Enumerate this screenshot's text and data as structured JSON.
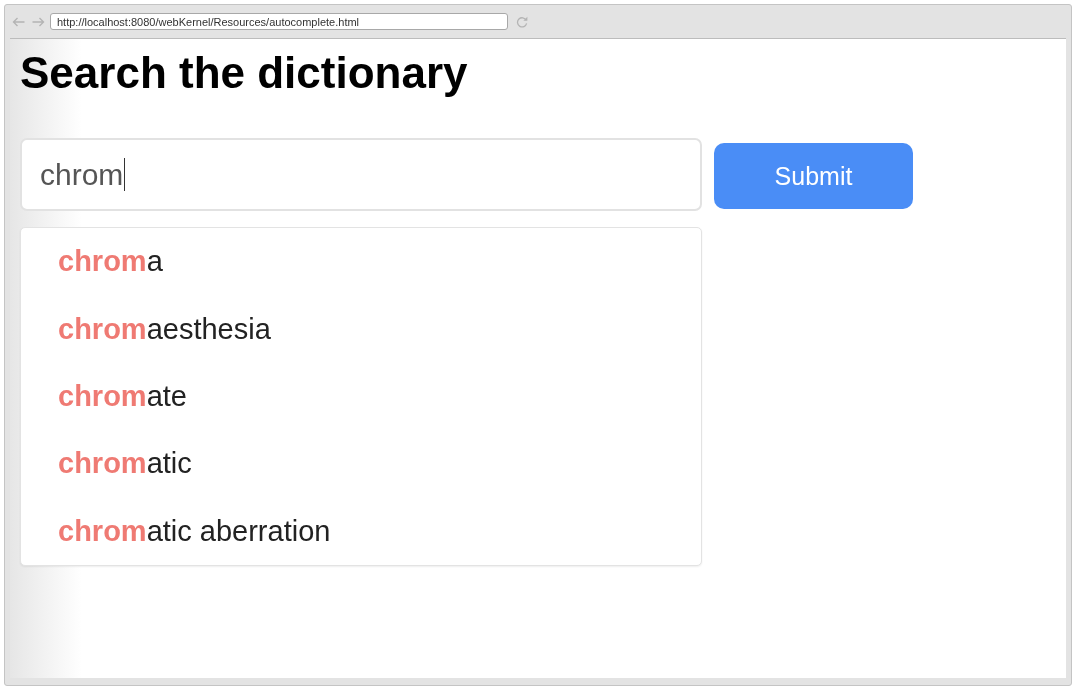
{
  "browser": {
    "url": "http://localhost:8080/webKernel/Resources/autocomplete.html"
  },
  "page": {
    "heading": "Search the dictionary"
  },
  "search": {
    "value": "chrom",
    "focused": true
  },
  "submit_button": {
    "label": "Submit"
  },
  "suggestions": [
    {
      "match": "chrom",
      "rest": "a",
      "selected": false
    },
    {
      "match": "chrom",
      "rest": "aesthesia",
      "selected": false
    },
    {
      "match": "chrom",
      "rest": "ate",
      "selected": false
    },
    {
      "match": "chrom",
      "rest": "atic",
      "selected": false
    },
    {
      "match": "chrom",
      "rest": "atic aberration",
      "selected": false
    }
  ]
}
